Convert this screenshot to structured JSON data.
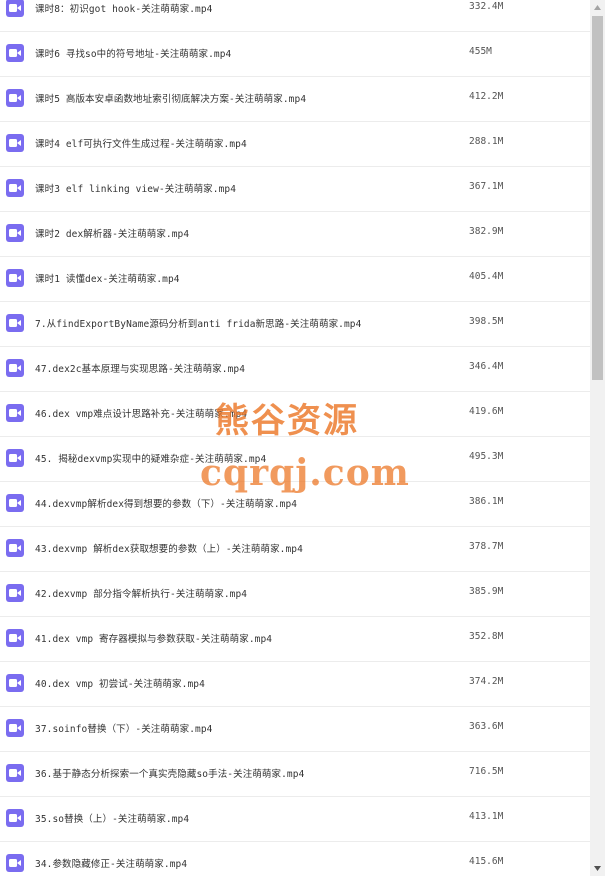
{
  "files": [
    {
      "name": "课时8：初识got hook-关注萌萌家.mp4",
      "size": "332.4M"
    },
    {
      "name": "课时6 寻找so中的符号地址-关注萌萌家.mp4",
      "size": "455M"
    },
    {
      "name": "课时5 高版本安卓函数地址索引彻底解决方案-关注萌萌家.mp4",
      "size": "412.2M"
    },
    {
      "name": "课时4 elf可执行文件生成过程-关注萌萌家.mp4",
      "size": "288.1M"
    },
    {
      "name": "课时3 elf linking view-关注萌萌家.mp4",
      "size": "367.1M"
    },
    {
      "name": "课时2 dex解析器-关注萌萌家.mp4",
      "size": "382.9M"
    },
    {
      "name": "课时1 读懂dex-关注萌萌家.mp4",
      "size": "405.4M"
    },
    {
      "name": "7.从findExportByName源码分析到anti frida新思路-关注萌萌家.mp4",
      "size": "398.5M"
    },
    {
      "name": "47.dex2c基本原理与实现思路-关注萌萌家.mp4",
      "size": "346.4M"
    },
    {
      "name": "46.dex vmp难点设计思路补充-关注萌萌家.mp4",
      "size": "419.6M"
    },
    {
      "name": "45. 揭秘dexvmp实现中的疑难杂症-关注萌萌家.mp4",
      "size": "495.3M"
    },
    {
      "name": "44.dexvmp解析dex得到想要的参数（下）-关注萌萌家.mp4",
      "size": "386.1M"
    },
    {
      "name": "43.dexvmp 解析dex获取想要的参数（上）-关注萌萌家.mp4",
      "size": "378.7M"
    },
    {
      "name": "42.dexvmp 部分指令解析执行-关注萌萌家.mp4",
      "size": "385.9M"
    },
    {
      "name": "41.dex vmp 寄存器模拟与参数获取-关注萌萌家.mp4",
      "size": "352.8M"
    },
    {
      "name": "40.dex vmp 初尝试-关注萌萌家.mp4",
      "size": "374.2M"
    },
    {
      "name": "37.soinfo替换（下）-关注萌萌家.mp4",
      "size": "363.6M"
    },
    {
      "name": "36.基于静态分析探索一个真实壳隐藏so手法-关注萌萌家.mp4",
      "size": "716.5M"
    },
    {
      "name": "35.so替换（上）-关注萌萌家.mp4",
      "size": "413.1M"
    },
    {
      "name": "34.参数隐藏修正-关注萌萌家.mp4",
      "size": "415.6M"
    }
  ],
  "watermark": {
    "line1": "熊谷资源",
    "line2": "cqrqj.com"
  },
  "colors": {
    "file_icon": "#7a6cf0",
    "watermark": "#ec7828",
    "scrollbar_track": "#f1f1f1",
    "scrollbar_thumb": "#c1c1c1"
  },
  "icons": {
    "file_type": "video-camera-icon",
    "scroll_up": "triangle-up-icon",
    "scroll_down": "triangle-down-icon"
  }
}
